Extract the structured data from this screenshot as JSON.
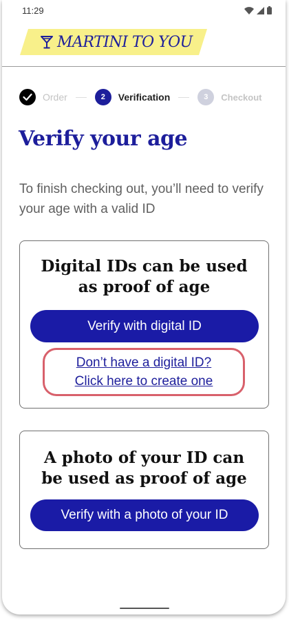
{
  "status_bar": {
    "time": "11:29"
  },
  "brand": {
    "name": "MARTINI TO YOU",
    "logo_icon": "martini-glass-icon",
    "highlight_color": "#f8f08a",
    "primary_color": "#1d1e9b"
  },
  "stepper": {
    "steps": [
      {
        "label": "Order",
        "state": "done"
      },
      {
        "label": "Verification",
        "number": "2",
        "state": "current"
      },
      {
        "label": "Checkout",
        "number": "3",
        "state": "upcoming"
      }
    ]
  },
  "page": {
    "title": "Verify your age",
    "intro": "To finish checking out, you’ll need to verify your age with a valid ID"
  },
  "digital_card": {
    "title": "Digital IDs can be used as proof of age",
    "button_label": "Verify with digital ID",
    "link_line1": "Don’t have a digital ID?",
    "link_line2": "Click here to create one"
  },
  "photo_card": {
    "title": "A photo of your ID can be used as proof of age",
    "button_label": "Verify with a photo of your ID"
  }
}
